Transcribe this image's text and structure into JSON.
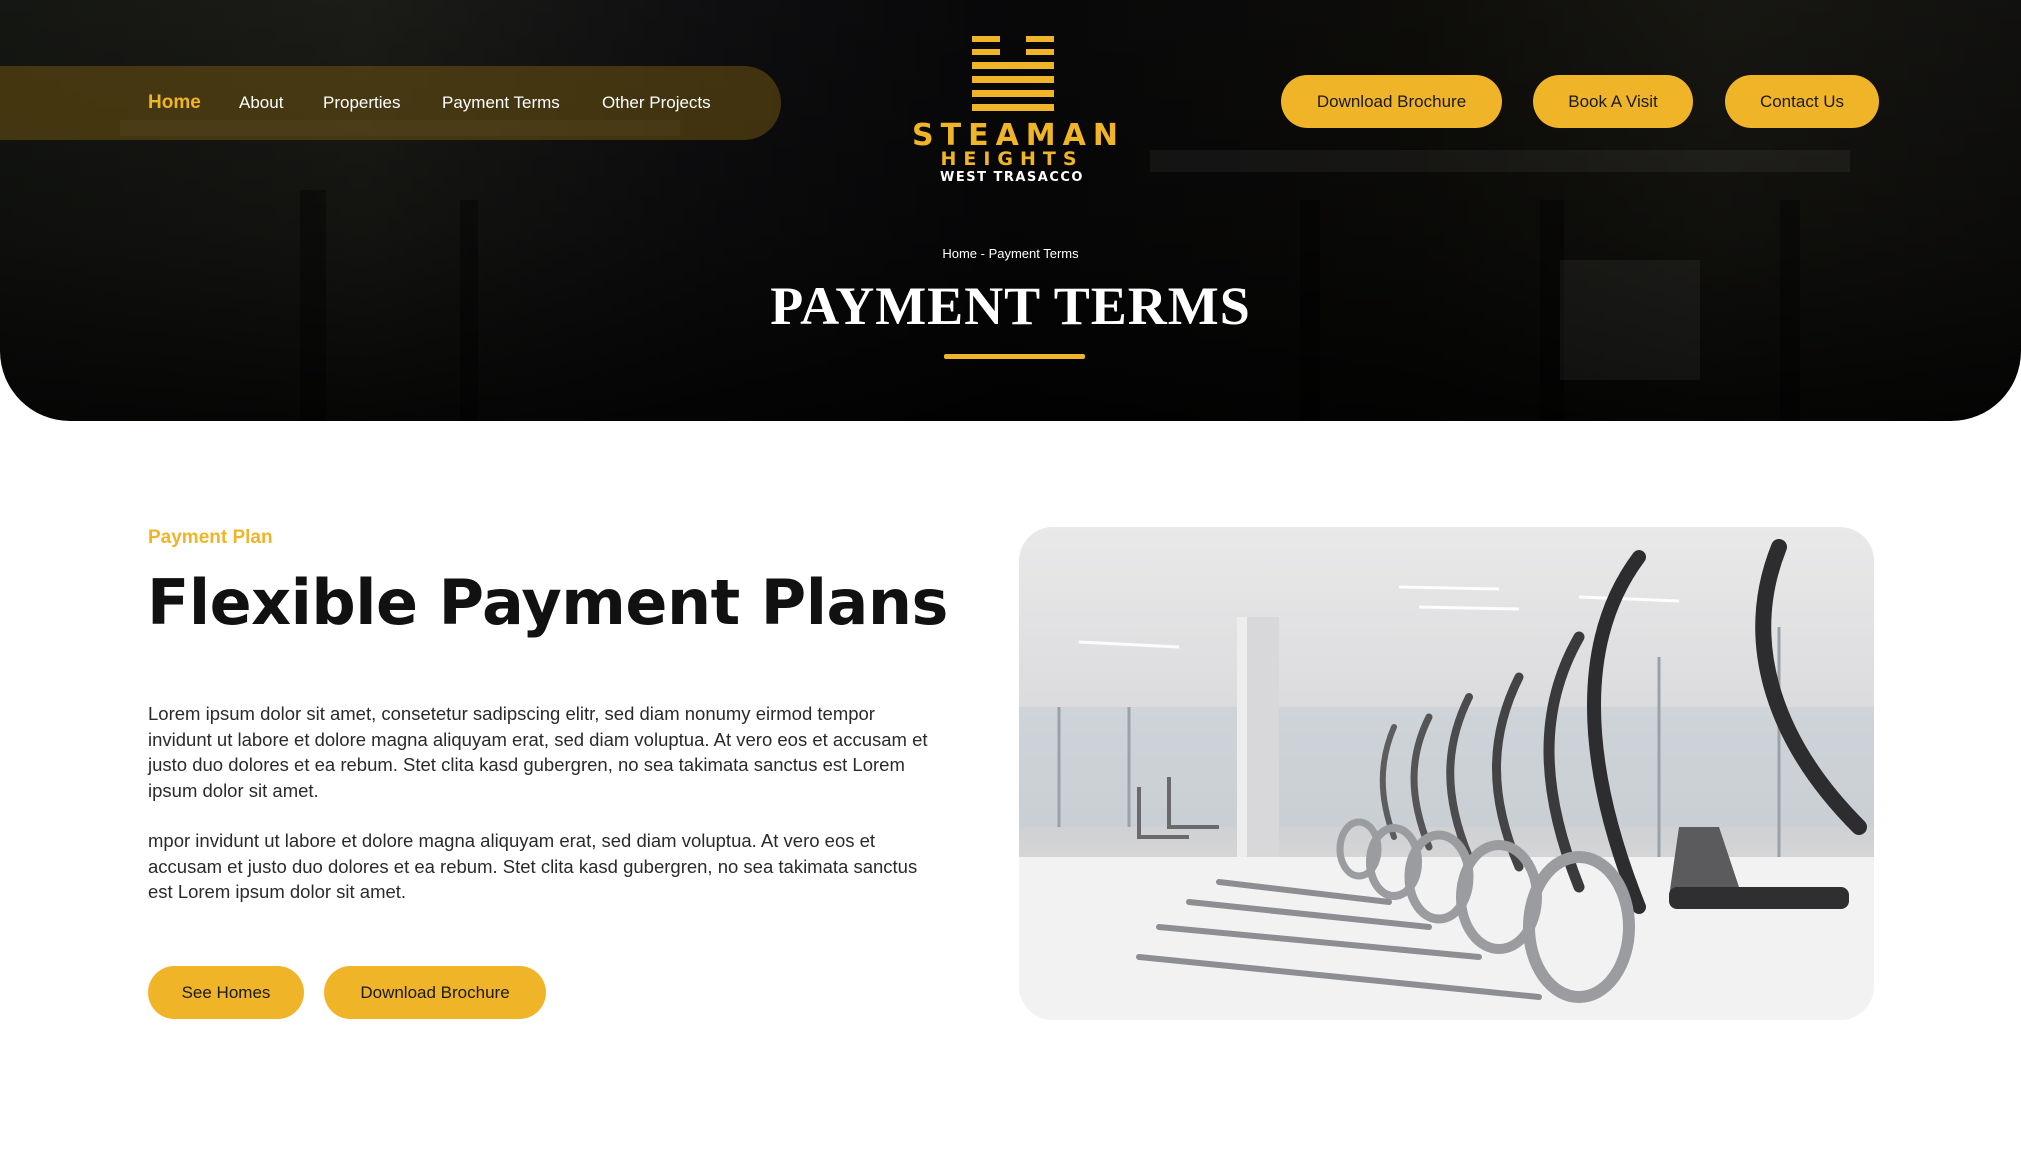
{
  "brand": {
    "line1": "STEAMAN",
    "line2": "HEIGHTS",
    "line3": "WEST TRASACCO",
    "accent_color": "#f0b429"
  },
  "nav": {
    "items": [
      {
        "label": "Home",
        "active": true
      },
      {
        "label": "About"
      },
      {
        "label": "Properties"
      },
      {
        "label": "Payment Terms"
      },
      {
        "label": "Other Projects"
      }
    ]
  },
  "header_actions": {
    "download_brochure": "Download Brochure",
    "book_visit": "Book A Visit",
    "contact_us": "Contact Us"
  },
  "hero": {
    "breadcrumb": "Home - Payment Terms",
    "title": "PAYMENT TERMS"
  },
  "main": {
    "eyebrow": "Payment Plan",
    "headline": "Flexible Payment Plans",
    "paragraphs": [
      "Lorem ipsum dolor sit amet, consetetur sadipscing elitr, sed diam nonumy eirmod tempor invidunt ut labore et dolore magna aliquyam erat, sed diam voluptua. At vero eos et accusam et justo duo dolores et ea rebum. Stet clita kasd gubergren, no sea takimata sanctus est Lorem ipsum dolor sit amet.",
      "mpor invidunt ut labore et dolore magna aliquyam erat, sed diam voluptua. At vero eos et accusam et justo duo dolores et ea rebum. Stet clita kasd gubergren, no sea takimata sanctus est Lorem ipsum dolor sit amet."
    ],
    "buttons": {
      "see_homes": "See Homes",
      "download_brochure": "Download Brochure"
    }
  }
}
